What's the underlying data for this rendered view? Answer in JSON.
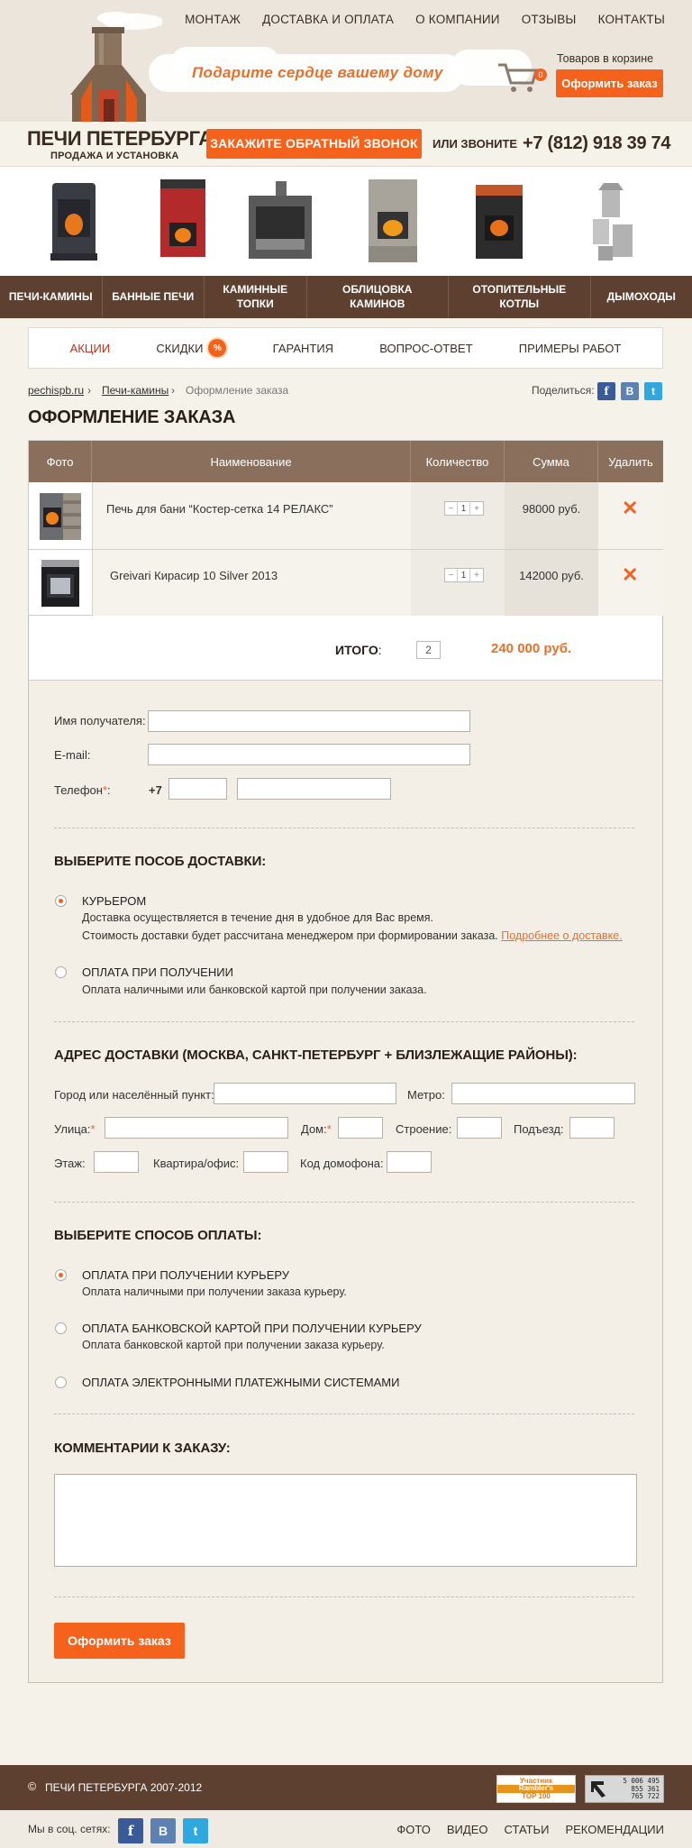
{
  "header": {
    "top_nav": [
      "МОНТАЖ",
      "ДОСТАВКА И ОПЛАТА",
      "О КОМПАНИИ",
      "ОТЗЫВЫ",
      "КОНТАКТЫ"
    ],
    "slogan": "Подарите сердце вашему дому",
    "cart_label": "Товаров в корзине",
    "cart_count": "0",
    "checkout_btn": "Оформить заказ",
    "logo_title": "ПЕЧИ ПЕТЕРБУРГА",
    "logo_subtitle": "ПРОДАЖА И УСТАНОВКА",
    "callback_btn": "ЗАКАЖИТЕ ОБРАТНЫЙ ЗВОНОК",
    "or_call": "ИЛИ  ЗВОНИТЕ",
    "phone": "+7 (812) 918 39 74"
  },
  "categories": [
    "ПЕЧИ-КАМИНЫ",
    "БАННЫЕ ПЕЧИ",
    "КАМИННЫЕ ТОПКИ",
    "ОБЛИЦОВКА КАМИНОВ",
    "ОТОПИТЕЛЬНЫЕ КОТЛЫ",
    "ДЫМОХОДЫ"
  ],
  "subnav": [
    "АКЦИИ",
    "СКИДКИ",
    "ГАРАНТИЯ",
    "ВОПРОС-ОТВЕТ",
    "ПРИМЕРЫ РАБОТ"
  ],
  "subnav_badge": "%",
  "breadcrumb": [
    "pechispb.ru",
    "Печи-камины",
    "Оформление заказа"
  ],
  "share_label": "Поделиться:",
  "social_letters": [
    "f",
    "B",
    "t"
  ],
  "page_title": "ОФОРМЛЕНИЕ ЗАКАЗА",
  "table": {
    "headers": [
      "Фото",
      "Наименование",
      "Количество",
      "Сумма",
      "Удалить"
    ],
    "rows": [
      {
        "name": "Печь для бани “Костер-сетка 14 РЕЛАКС”",
        "qty": "1",
        "sum": "98000 руб."
      },
      {
        "name": "Greivari Кирасир 10 Silver 2013",
        "qty": "1",
        "sum": "142000 руб."
      }
    ],
    "minus": "−",
    "plus": "+",
    "delete_symbol": "✕",
    "total_label": "ИТОГО",
    "total_qty": "2",
    "total_sum": "240 000 руб."
  },
  "form": {
    "name_label": "Имя получателя:",
    "email_label": "E-mail:",
    "phone_label": "Телефон",
    "phone_prefix": "+7",
    "delivery_title": "ВЫБЕРИТЕ ПОСОБ ДОСТАВКИ:",
    "courier_label": "КУРЬЕРОМ",
    "courier_desc1": "Доставка осуществляется в течение дня в удобное для Вас время.",
    "courier_desc2": "Стоимость доставки будет рассчитана менеджером при формировании заказа.",
    "courier_link": "Подробнее о доставке.",
    "pickup_label": "ОПЛАТА ПРИ ПОЛУЧЕНИИ",
    "pickup_desc": "Оплата наличными или банковской картой при получении заказа.",
    "address_title": "АДРЕС ДОСТАВКИ (МОСКВА, САНКТ-ПЕТЕРБУРГ + БЛИЗЛЕЖАЩИЕ РАЙОНЫ):",
    "city_label": "Город или населённый пункт:",
    "metro_label": "Метро:",
    "street_label": "Улица:",
    "house_label": "Дом:",
    "building_label": "Строение:",
    "entrance_label": "Подъезд:",
    "floor_label": "Этаж:",
    "apt_label": "Квартира/офис:",
    "code_label": "Код домофона:",
    "payment_title": "ВЫБЕРИТЕ СПОСОБ ОПЛАТЫ:",
    "pay1_label": "ОПЛАТА ПРИ ПОЛУЧЕНИИ КУРЬЕРУ",
    "pay1_desc": "Оплата наличными при получении заказа курьеру.",
    "pay2_label": "ОПЛАТА БАНКОВСКОЙ КАРТОЙ ПРИ ПОЛУЧЕНИИ КУРЬЕРУ",
    "pay2_desc": "Оплата банковской картой при получении заказа курьеру.",
    "pay3_label": "ОПЛАТА ЭЛЕКТРОННЫМИ ПЛАТЕЖНЫМИ СИСТЕМАМИ",
    "comments_title": "КОММЕНТАРИИ К ЗАКАЗУ:",
    "submit_btn": "Оформить заказ"
  },
  "footer": {
    "copyright": "ПЕЧИ ПЕТЕРБУРГА 2007-2012",
    "rambler_line1": "Участник",
    "rambler_line2": "Rambler's",
    "rambler_line3": "TOP 100",
    "counter_values": [
      "5 006 495",
      "855 361",
      "765 722"
    ],
    "social_label": "Мы в соц. сетях:",
    "links": [
      "ФОТО",
      "ВИДЕО",
      "СТАТЬИ",
      "РЕКОМЕНДАЦИИ"
    ]
  },
  "colors": {
    "accent": "#f5621c",
    "brown": "#5e4030",
    "header_bg": "#ece5db",
    "table_head": "#8a705c"
  }
}
